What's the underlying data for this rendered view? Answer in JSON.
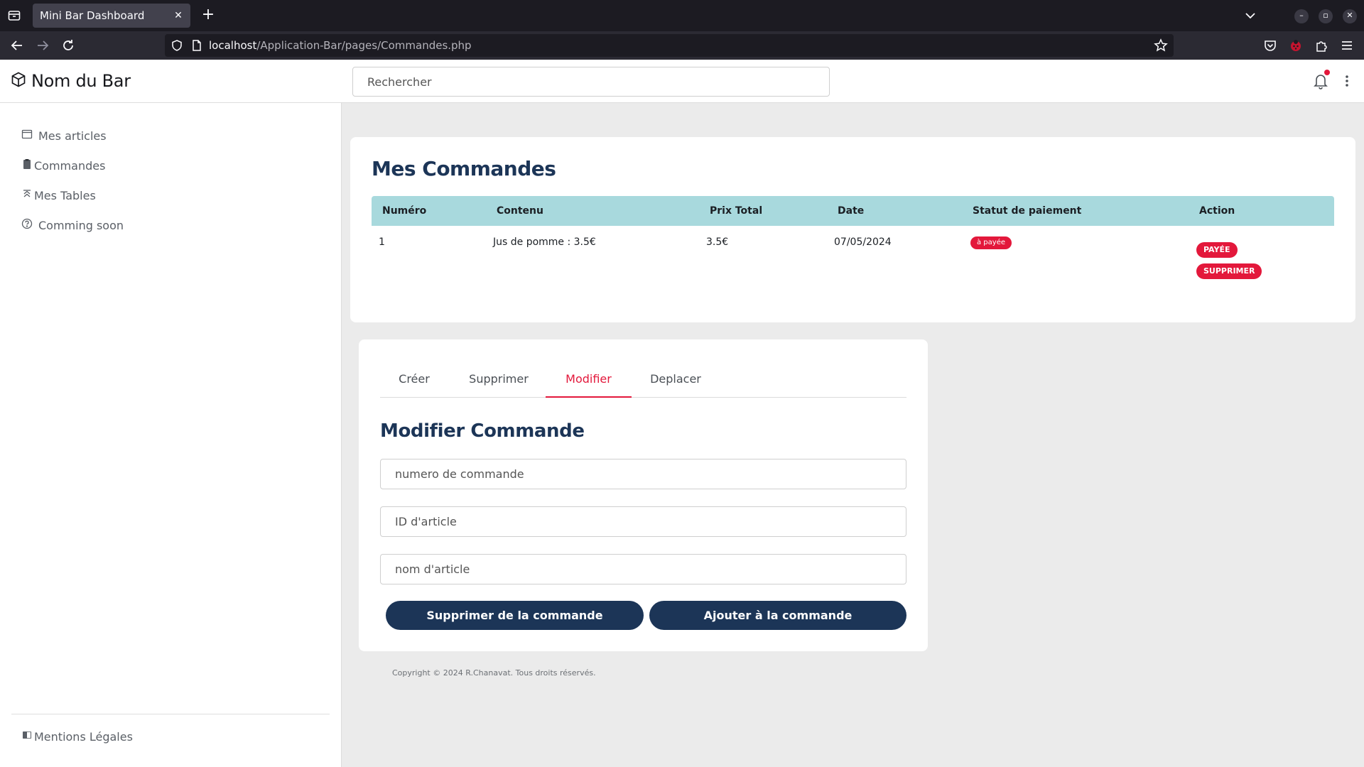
{
  "browser": {
    "tab_title": "Mini Bar Dashboard",
    "tab_close": "✕",
    "new_tab": "+",
    "url_host": "localhost",
    "url_path": "/Application-Bar/pages/Commandes.php",
    "win_min": "–",
    "win_max": "▫",
    "win_close": "✕"
  },
  "header": {
    "brand": "Nom du Bar",
    "search_placeholder": "Rechercher"
  },
  "sidebar": {
    "items": [
      {
        "label": "Mes articles",
        "icon": "calendar-icon"
      },
      {
        "label": "Commandes",
        "icon": "clipboard-icon"
      },
      {
        "label": "Mes Tables",
        "icon": "chevron-double-up-icon"
      },
      {
        "label": "Comming soon",
        "icon": "question-circle-icon"
      }
    ],
    "footer_item": {
      "label": "Mentions Légales",
      "icon": "book-icon"
    }
  },
  "orders": {
    "title": "Mes Commandes",
    "columns": [
      "Numéro",
      "Contenu",
      "Prix Total",
      "Date",
      "Statut de paiement",
      "Action"
    ],
    "rows": [
      {
        "numero": "1",
        "contenu": "Jus de pomme : 3.5€",
        "prix_total": "3.5€",
        "date": "07/05/2024",
        "statut": "à payée",
        "actions": [
          "PAYÉE",
          "SUPPRIMER"
        ]
      }
    ]
  },
  "form": {
    "tabs": [
      "Créer",
      "Supprimer",
      "Modifier",
      "Deplacer"
    ],
    "active_tab": "Modifier",
    "title": "Modifier Commande",
    "fields": [
      {
        "placeholder": "numero de commande"
      },
      {
        "placeholder": "ID d'article"
      },
      {
        "placeholder": "nom d'article"
      }
    ],
    "buttons": {
      "remove": "Supprimer de la commande",
      "add": "Ajouter à la commande"
    }
  },
  "footer": {
    "copyright": "Copyright © 2024 R.Chanavat. Tous droits réservés."
  },
  "colors": {
    "accent_red": "#e3183b",
    "navy": "#1c3557",
    "table_header": "#a8d9dd"
  }
}
